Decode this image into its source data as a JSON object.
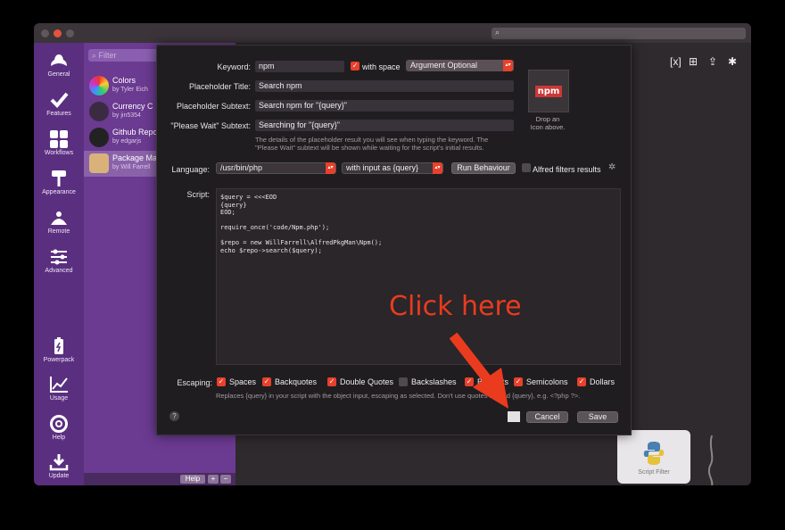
{
  "titlebar": {
    "search_icon": "search-icon"
  },
  "rail": {
    "items": [
      {
        "label": "General",
        "icon": "hat-icon"
      },
      {
        "label": "Features",
        "icon": "checkmark-icon"
      },
      {
        "label": "Workflows",
        "icon": "grid-icon"
      },
      {
        "label": "Appearance",
        "icon": "paint-roller-icon"
      },
      {
        "label": "Remote",
        "icon": "remote-icon"
      },
      {
        "label": "Advanced",
        "icon": "sliders-icon"
      },
      {
        "label": "Powerpack",
        "icon": "battery-icon"
      },
      {
        "label": "Usage",
        "icon": "chart-icon"
      },
      {
        "label": "Help",
        "icon": "lifebuoy-icon"
      },
      {
        "label": "Update",
        "icon": "download-icon"
      }
    ]
  },
  "workflows": {
    "filter_placeholder": "Filter",
    "items": [
      {
        "title": "Colors",
        "subtitle": "by Tyler Eich"
      },
      {
        "title": "Currency C",
        "subtitle": "by jin5354"
      },
      {
        "title": "Github Repo",
        "subtitle": "by edgarjs"
      },
      {
        "title": "Package Ma",
        "subtitle": "by Will Farrell"
      }
    ],
    "help_label": "Help",
    "add_label": "+",
    "remove_label": "−"
  },
  "canvas": {
    "script_filter_label": "Script Filter"
  },
  "dialog": {
    "keyword_label": "Keyword:",
    "keyword_value": "npm",
    "with_space_label": "with space",
    "argument_option": "Argument Optional",
    "placeholder_title_label": "Placeholder Title:",
    "placeholder_title_value": "Search npm",
    "placeholder_subtext_label": "Placeholder Subtext:",
    "placeholder_subtext_value": "Search npm for \"{query}\"",
    "please_wait_label": "\"Please Wait\" Subtext:",
    "please_wait_value": "Searching for \"{query}\"",
    "hint1": "The details of the placeholder result you will see when typing the keyword. The",
    "hint2": "\"Please Wait\" subtext will be shown while waiting for the script's initial results.",
    "icon_logo_text": "npm",
    "icon_drop_text1": "Drop an",
    "icon_drop_text2": "Icon above.",
    "language_label": "Language:",
    "language_value": "/usr/bin/php",
    "input_mode": "with input as {query}",
    "run_behaviour": "Run Behaviour",
    "alfred_filters": "Alfred filters results",
    "script_label": "Script:",
    "script_code": "$query = <<<EOD\n{query}\nEOD;\n\nrequire_once('code/Npm.php');\n\n$repo = new WillFarrell\\AlfredPkgMan\\Npm();\necho $repo->search($query);",
    "escaping_label": "Escaping:",
    "escaping": [
      {
        "label": "Spaces",
        "checked": true
      },
      {
        "label": "Backquotes",
        "checked": true
      },
      {
        "label": "Double Quotes",
        "checked": true
      },
      {
        "label": "Backslashes",
        "checked": false
      },
      {
        "label": "Brackets",
        "checked": true
      },
      {
        "label": "Semicolons",
        "checked": true
      },
      {
        "label": "Dollars",
        "checked": true
      }
    ],
    "escaping_hint": "Replaces {query} in your script with the object input, escaping as selected. Don't use quotes around {query}, e.g. <?php ?>.",
    "cancel_label": "Cancel",
    "save_label": "Save",
    "help_glyph": "?"
  },
  "annotation": {
    "text": "Click here",
    "color": "#ea3b1f"
  },
  "colors": {
    "accent": "#e8402b",
    "sidebar": "#5b2f80",
    "list": "#6b3a91"
  }
}
